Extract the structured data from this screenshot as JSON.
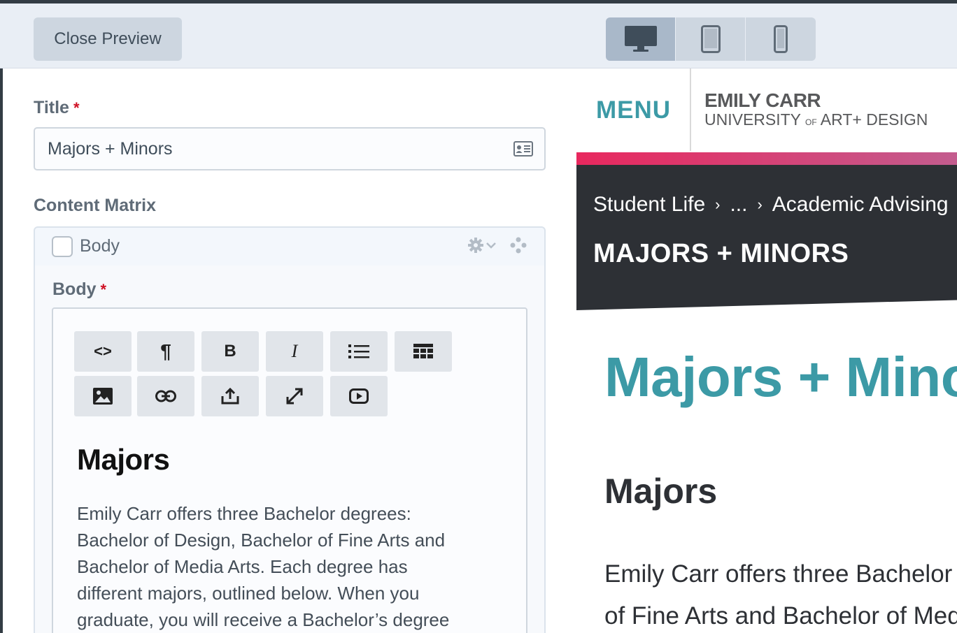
{
  "toolbar": {
    "close_label": "Close Preview",
    "devices": [
      "desktop-icon",
      "tablet-icon",
      "phone-icon"
    ]
  },
  "form": {
    "title_label": "Title",
    "required_mark": "*",
    "title_value": "Majors + Minors",
    "content_matrix_label": "Content Matrix",
    "block_name": "Body",
    "body_label": "Body"
  },
  "rte": {
    "toolbar_row1": [
      "<>",
      "¶",
      "B",
      "I",
      "list-icon",
      "table-icon"
    ],
    "toolbar_row2": [
      "image-icon",
      "link-icon",
      "upload-icon",
      "fullscreen-icon",
      "video-icon"
    ],
    "heading": "Majors",
    "lines": [
      "Emily Carr offers three Bachelor degrees:",
      "Bachelor of Design, Bachelor of Fine Arts and",
      "Bachelor of Media Arts. Each degree has",
      "different majors, outlined below. When you",
      "graduate, you will receive a Bachelor’s degree"
    ]
  },
  "preview": {
    "menu": "MENU",
    "logo_line1": "EMILY CARR",
    "logo_line2_a": "UNIVERSITY",
    "logo_line2_of": "OF",
    "logo_line2_b": "ART+ DESIGN",
    "crumbs": [
      "Student Life",
      "...",
      "Academic Advising"
    ],
    "hero_title": "MAJORS + MINORS",
    "page_title": "Majors + Minors",
    "section_heading": "Majors",
    "lines": [
      "Emily Carr offers three Bachelor degrees: Bachelor of Design,",
      "of Fine Arts and Bachelor of Media Arts."
    ]
  },
  "colors": {
    "accent_teal": "#3c9aa6",
    "hero_bg": "#2d3035",
    "gradient_start": "#e8285e",
    "required": "#cf1124"
  }
}
